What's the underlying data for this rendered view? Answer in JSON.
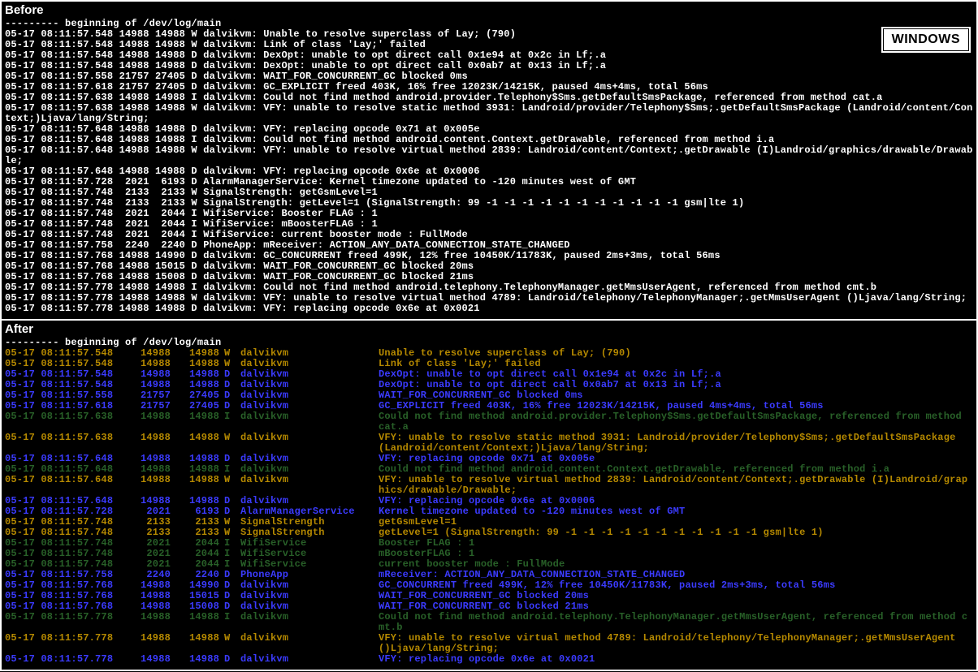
{
  "labels": {
    "before": "Before",
    "after": "After",
    "windows_badge": "WINDOWS"
  },
  "begin_line": "--------- beginning of /dev/log/main",
  "before_log": [
    "05-17 08:11:57.548 14988 14988 W dalvikvm: Unable to resolve superclass of Lay; (790)",
    "05-17 08:11:57.548 14988 14988 W dalvikvm: Link of class 'Lay;' failed",
    "05-17 08:11:57.548 14988 14988 D dalvikvm: DexOpt: unable to opt direct call 0x1e94 at 0x2c in Lf;.a",
    "05-17 08:11:57.548 14988 14988 D dalvikvm: DexOpt: unable to opt direct call 0x0ab7 at 0x13 in Lf;.a",
    "05-17 08:11:57.558 21757 27405 D dalvikvm: WAIT_FOR_CONCURRENT_GC blocked 0ms",
    "05-17 08:11:57.618 21757 27405 D dalvikvm: GC_EXPLICIT freed 403K, 16% free 12023K/14215K, paused 4ms+4ms, total 56ms",
    "05-17 08:11:57.638 14988 14988 I dalvikvm: Could not find method android.provider.Telephony$Sms.getDefaultSmsPackage, referenced from method cat.a",
    "05-17 08:11:57.638 14988 14988 W dalvikvm: VFY: unable to resolve static method 3931: Landroid/provider/Telephony$Sms;.getDefaultSmsPackage (Landroid/content/Context;)Ljava/lang/String;",
    "05-17 08:11:57.648 14988 14988 D dalvikvm: VFY: replacing opcode 0x71 at 0x005e",
    "05-17 08:11:57.648 14988 14988 I dalvikvm: Could not find method android.content.Context.getDrawable, referenced from method i.a",
    "05-17 08:11:57.648 14988 14988 W dalvikvm: VFY: unable to resolve virtual method 2839: Landroid/content/Context;.getDrawable (I)Landroid/graphics/drawable/Drawable;",
    "05-17 08:11:57.648 14988 14988 D dalvikvm: VFY: replacing opcode 0x6e at 0x0006",
    "05-17 08:11:57.728  2021  6193 D AlarmManagerService: Kernel timezone updated to -120 minutes west of GMT",
    "05-17 08:11:57.748  2133  2133 W SignalStrength: getGsmLevel=1",
    "05-17 08:11:57.748  2133  2133 W SignalStrength: getLevel=1 (SignalStrength: 99 -1 -1 -1 -1 -1 -1 -1 -1 -1 -1 -1 gsm|lte 1)",
    "05-17 08:11:57.748  2021  2044 I WifiService: Booster FLAG : 1",
    "05-17 08:11:57.748  2021  2044 I WifiService: mBoosterFLAG : 1",
    "05-17 08:11:57.748  2021  2044 I WifiService: current booster mode : FullMode",
    "05-17 08:11:57.758  2240  2240 D PhoneApp: mReceiver: ACTION_ANY_DATA_CONNECTION_STATE_CHANGED",
    "05-17 08:11:57.768 14988 14990 D dalvikvm: GC_CONCURRENT freed 499K, 12% free 10450K/11783K, paused 2ms+3ms, total 56ms",
    "05-17 08:11:57.768 14988 15015 D dalvikvm: WAIT_FOR_CONCURRENT_GC blocked 20ms",
    "05-17 08:11:57.768 14988 15008 D dalvikvm: WAIT_FOR_CONCURRENT_GC blocked 21ms",
    "05-17 08:11:57.778 14988 14988 I dalvikvm: Could not find method android.telephony.TelephonyManager.getMmsUserAgent, referenced from method cmt.b",
    "05-17 08:11:57.778 14988 14988 W dalvikvm: VFY: unable to resolve virtual method 4789: Landroid/telephony/TelephonyManager;.getMmsUserAgent ()Ljava/lang/String;",
    "05-17 08:11:57.778 14988 14988 D dalvikvm: VFY: replacing opcode 0x6e at 0x0021"
  ],
  "after_log": [
    {
      "dt": "05-17 08:11:57.548",
      "pid": "14988",
      "tid": "14988",
      "lvl": "W",
      "tag": "dalvikvm",
      "msg": "Unable to resolve superclass of Lay; (790)",
      "low": false
    },
    {
      "dt": "05-17 08:11:57.548",
      "pid": "14988",
      "tid": "14988",
      "lvl": "W",
      "tag": "dalvikvm",
      "msg": "Link of class 'Lay;' failed",
      "low": false
    },
    {
      "dt": "05-17 08:11:57.548",
      "pid": "14988",
      "tid": "14988",
      "lvl": "D",
      "tag": "dalvikvm",
      "msg": "DexOpt: unable to opt direct call 0x1e94 at 0x2c in Lf;.a",
      "low": false
    },
    {
      "dt": "05-17 08:11:57.548",
      "pid": "14988",
      "tid": "14988",
      "lvl": "D",
      "tag": "dalvikvm",
      "msg": "DexOpt: unable to opt direct call 0x0ab7 at 0x13 in Lf;.a",
      "low": false
    },
    {
      "dt": "05-17 08:11:57.558",
      "pid": "21757",
      "tid": "27405",
      "lvl": "D",
      "tag": "dalvikvm",
      "msg": "WAIT_FOR_CONCURRENT_GC blocked 0ms",
      "low": false
    },
    {
      "dt": "05-17 08:11:57.618",
      "pid": "21757",
      "tid": "27405",
      "lvl": "D",
      "tag": "dalvikvm",
      "msg": "GC_EXPLICIT freed 403K, 16% free 12023K/14215K, paused 4ms+4ms, total 56ms",
      "low": false
    },
    {
      "dt": "05-17 08:11:57.638",
      "pid": "14988",
      "tid": "14988",
      "lvl": "I",
      "tag": "dalvikvm",
      "msg": "Could not find method android.provider.Telephony$Sms.getDefaultSmsPackage, referenced from method cat.a",
      "low": true
    },
    {
      "dt": "05-17 08:11:57.638",
      "pid": "14988",
      "tid": "14988",
      "lvl": "W",
      "tag": "dalvikvm",
      "msg": "VFY: unable to resolve static method 3931: Landroid/provider/Telephony$Sms;.getDefaultSmsPackage (Landroid/content/Context;)Ljava/lang/String;",
      "low": false
    },
    {
      "dt": "05-17 08:11:57.648",
      "pid": "14988",
      "tid": "14988",
      "lvl": "D",
      "tag": "dalvikvm",
      "msg": "VFY: replacing opcode 0x71 at 0x005e",
      "low": false
    },
    {
      "dt": "05-17 08:11:57.648",
      "pid": "14988",
      "tid": "14988",
      "lvl": "I",
      "tag": "dalvikvm",
      "msg": "Could not find method android.content.Context.getDrawable, referenced from method i.a",
      "low": true
    },
    {
      "dt": "05-17 08:11:57.648",
      "pid": "14988",
      "tid": "14988",
      "lvl": "W",
      "tag": "dalvikvm",
      "msg": "VFY: unable to resolve virtual method 2839: Landroid/content/Context;.getDrawable (I)Landroid/graphics/drawable/Drawable;",
      "low": false
    },
    {
      "dt": "05-17 08:11:57.648",
      "pid": "14988",
      "tid": "14988",
      "lvl": "D",
      "tag": "dalvikvm",
      "msg": "VFY: replacing opcode 0x6e at 0x0006",
      "low": false
    },
    {
      "dt": "05-17 08:11:57.728",
      "pid": "2021",
      "tid": "6193",
      "lvl": "D",
      "tag": "AlarmManagerService",
      "msg": "Kernel timezone updated to -120 minutes west of GMT",
      "low": false
    },
    {
      "dt": "05-17 08:11:57.748",
      "pid": "2133",
      "tid": "2133",
      "lvl": "W",
      "tag": "SignalStrength",
      "msg": "getGsmLevel=1",
      "low": false
    },
    {
      "dt": "05-17 08:11:57.748",
      "pid": "2133",
      "tid": "2133",
      "lvl": "W",
      "tag": "SignalStrength",
      "msg": "getLevel=1 (SignalStrength: 99 -1 -1 -1 -1 -1 -1 -1 -1 -1 -1 -1 gsm|lte 1)",
      "low": false
    },
    {
      "dt": "05-17 08:11:57.748",
      "pid": "2021",
      "tid": "2044",
      "lvl": "I",
      "tag": "WifiService",
      "msg": "Booster FLAG : 1",
      "low": true
    },
    {
      "dt": "05-17 08:11:57.748",
      "pid": "2021",
      "tid": "2044",
      "lvl": "I",
      "tag": "WifiService",
      "msg": "mBoosterFLAG : 1",
      "low": true
    },
    {
      "dt": "05-17 08:11:57.748",
      "pid": "2021",
      "tid": "2044",
      "lvl": "I",
      "tag": "WifiService",
      "msg": "current booster mode : FullMode",
      "low": true
    },
    {
      "dt": "05-17 08:11:57.758",
      "pid": "2240",
      "tid": "2240",
      "lvl": "D",
      "tag": "PhoneApp",
      "msg": "mReceiver: ACTION_ANY_DATA_CONNECTION_STATE_CHANGED",
      "low": false
    },
    {
      "dt": "05-17 08:11:57.768",
      "pid": "14988",
      "tid": "14990",
      "lvl": "D",
      "tag": "dalvikvm",
      "msg": "GC_CONCURRENT freed 499K, 12% free 10450K/11783K, paused 2ms+3ms, total 56ms",
      "low": false
    },
    {
      "dt": "05-17 08:11:57.768",
      "pid": "14988",
      "tid": "15015",
      "lvl": "D",
      "tag": "dalvikvm",
      "msg": "WAIT_FOR_CONCURRENT_GC blocked 20ms",
      "low": false
    },
    {
      "dt": "05-17 08:11:57.768",
      "pid": "14988",
      "tid": "15008",
      "lvl": "D",
      "tag": "dalvikvm",
      "msg": "WAIT_FOR_CONCURRENT_GC blocked 21ms",
      "low": false
    },
    {
      "dt": "05-17 08:11:57.778",
      "pid": "14988",
      "tid": "14988",
      "lvl": "I",
      "tag": "dalvikvm",
      "msg": "Could not find method android.telephony.TelephonyManager.getMmsUserAgent, referenced from method cmt.b",
      "low": true
    },
    {
      "dt": "05-17 08:11:57.778",
      "pid": "14988",
      "tid": "14988",
      "lvl": "W",
      "tag": "dalvikvm",
      "msg": "VFY: unable to resolve virtual method 4789: Landroid/telephony/TelephonyManager;.getMmsUserAgent ()Ljava/lang/String;",
      "low": false
    },
    {
      "dt": "05-17 08:11:57.778",
      "pid": "14988",
      "tid": "14988",
      "lvl": "D",
      "tag": "dalvikvm",
      "msg": "VFY: replacing opcode 0x6e at 0x0021",
      "low": false
    }
  ]
}
